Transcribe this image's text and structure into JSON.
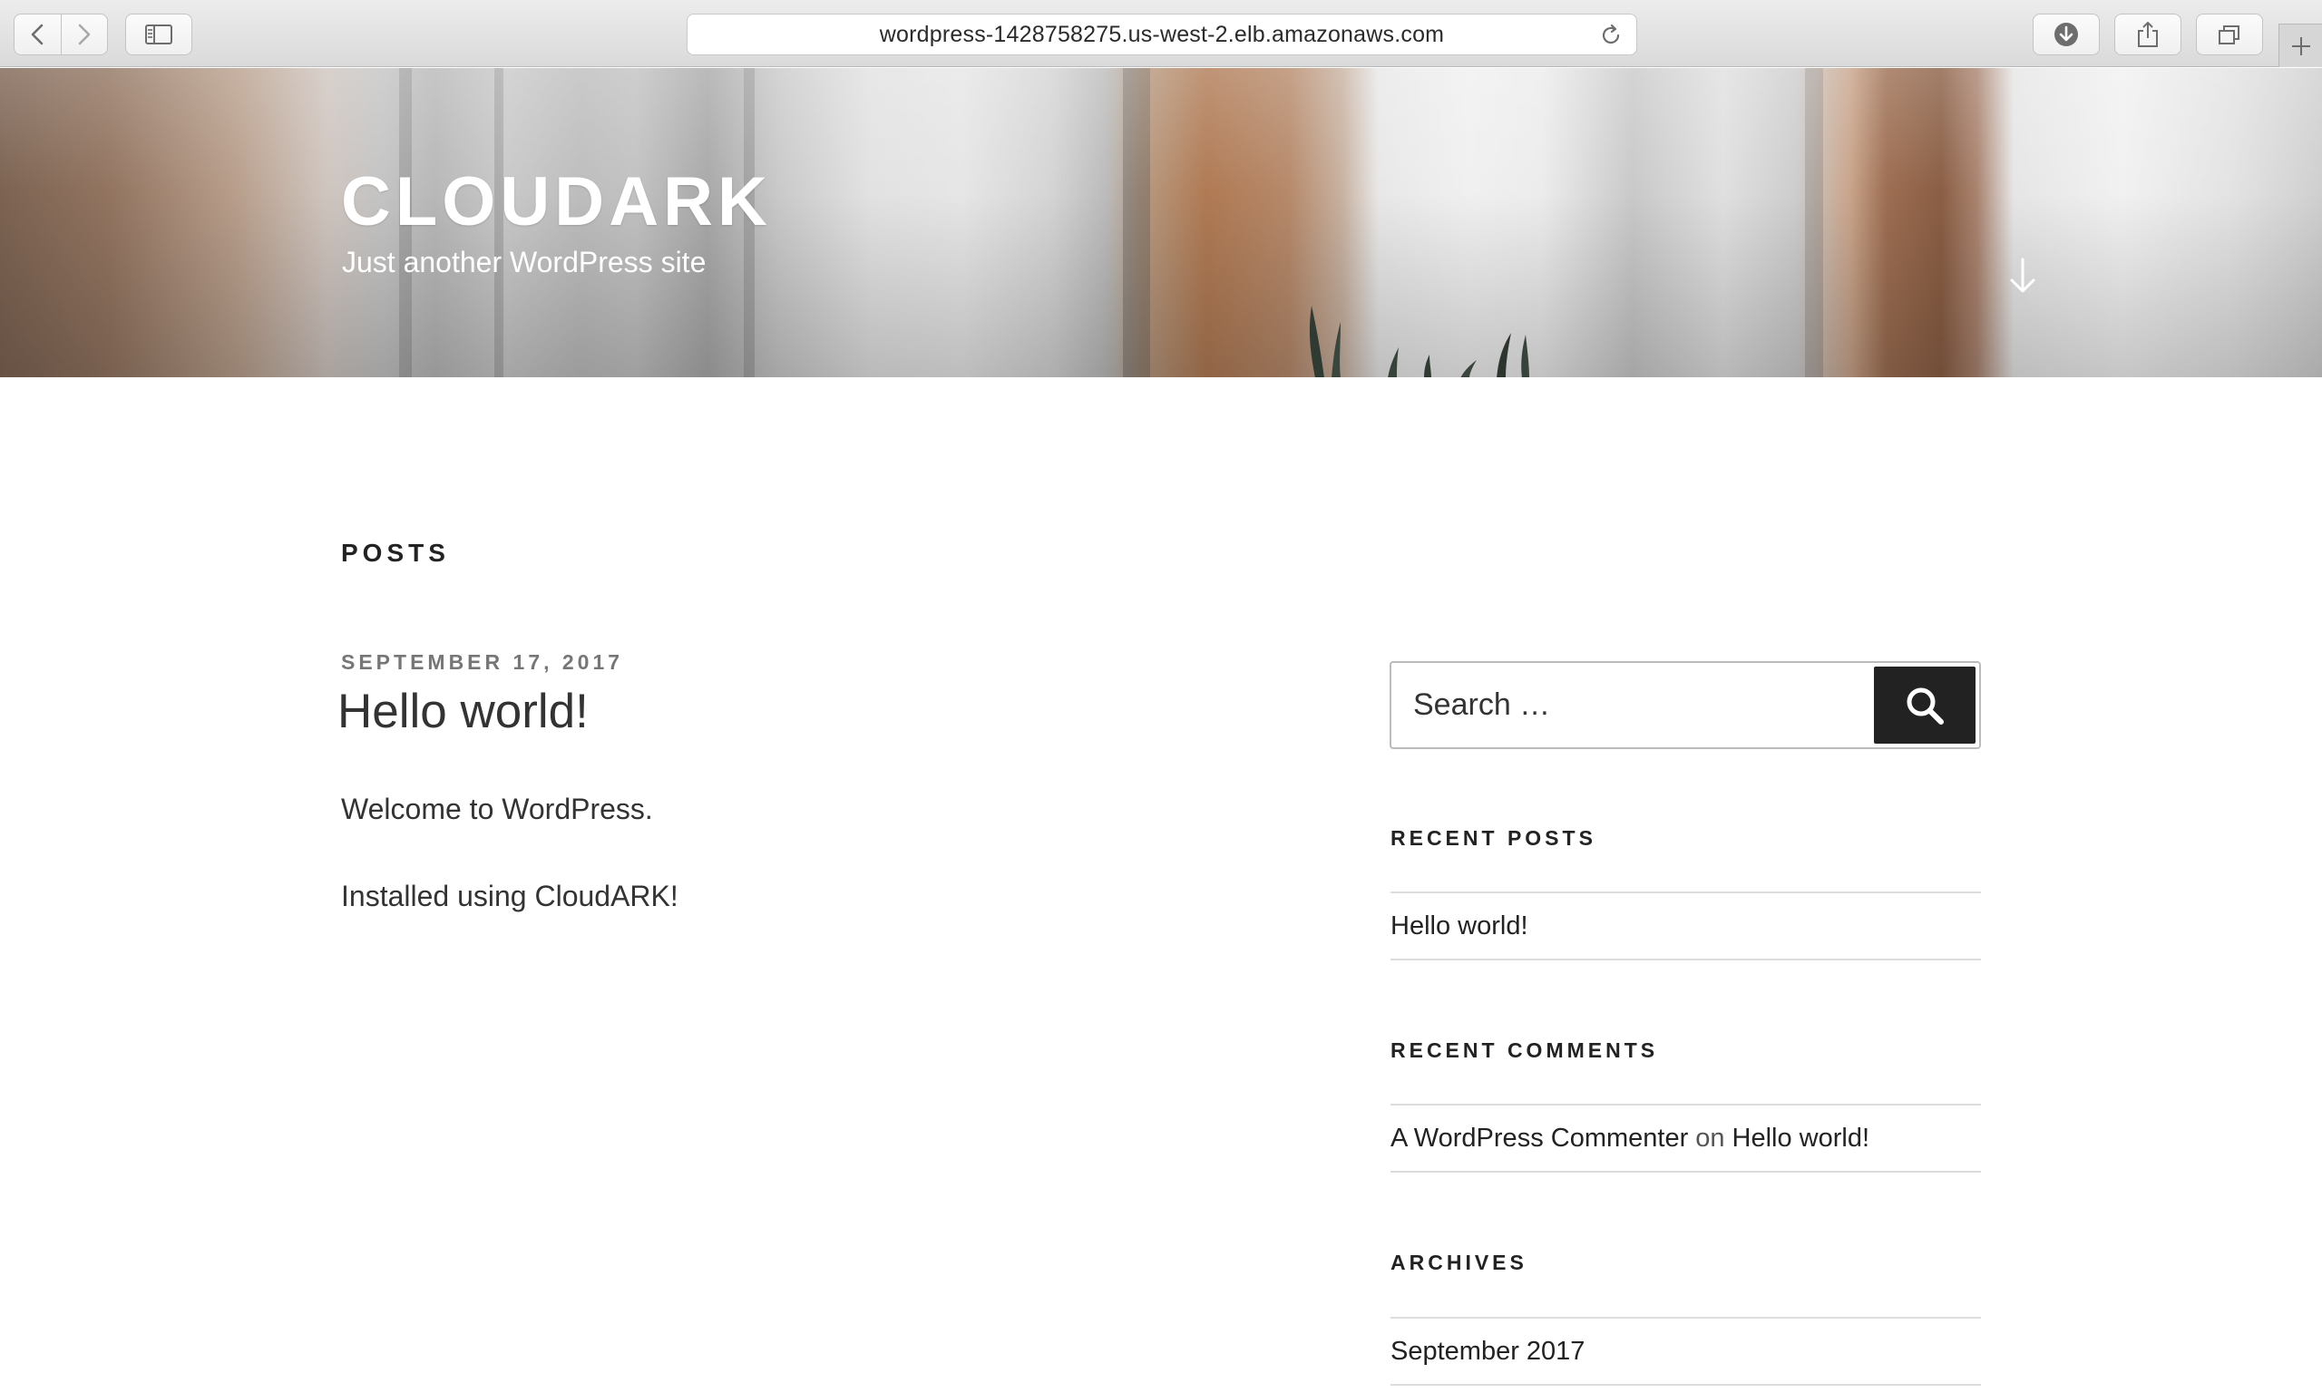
{
  "browser": {
    "url": "wordpress-1428758275.us-west-2.elb.amazonaws.com"
  },
  "site": {
    "title": "CLOUDARK",
    "description": "Just another WordPress site"
  },
  "main": {
    "section_heading": "POSTS",
    "post": {
      "date": "SEPTEMBER 17, 2017",
      "title": "Hello world!",
      "paragraphs": [
        "Welcome to WordPress.",
        "Installed using CloudARK!"
      ]
    }
  },
  "sidebar": {
    "search": {
      "placeholder": "Search …"
    },
    "recent_posts": {
      "title": "RECENT POSTS",
      "items": [
        "Hello world!"
      ]
    },
    "recent_comments": {
      "title": "RECENT COMMENTS",
      "items": [
        {
          "author": "A WordPress Commenter",
          "on": "on",
          "post": "Hello world!"
        }
      ]
    },
    "archives": {
      "title": "ARCHIVES",
      "items": [
        "September 2017"
      ]
    }
  },
  "icons": {
    "back": "chevron-left-icon",
    "forward": "chevron-right-icon",
    "sidebar": "sidebar-icon",
    "reload": "reload-icon",
    "downloads": "download-icon",
    "share": "share-icon",
    "tabs": "tabs-icon",
    "new_tab": "plus-icon",
    "scroll": "arrow-down-icon",
    "search": "search-icon"
  },
  "colors": {
    "text": "#222222",
    "meta": "#767676",
    "button": "#222222",
    "border": "#dddddd"
  }
}
